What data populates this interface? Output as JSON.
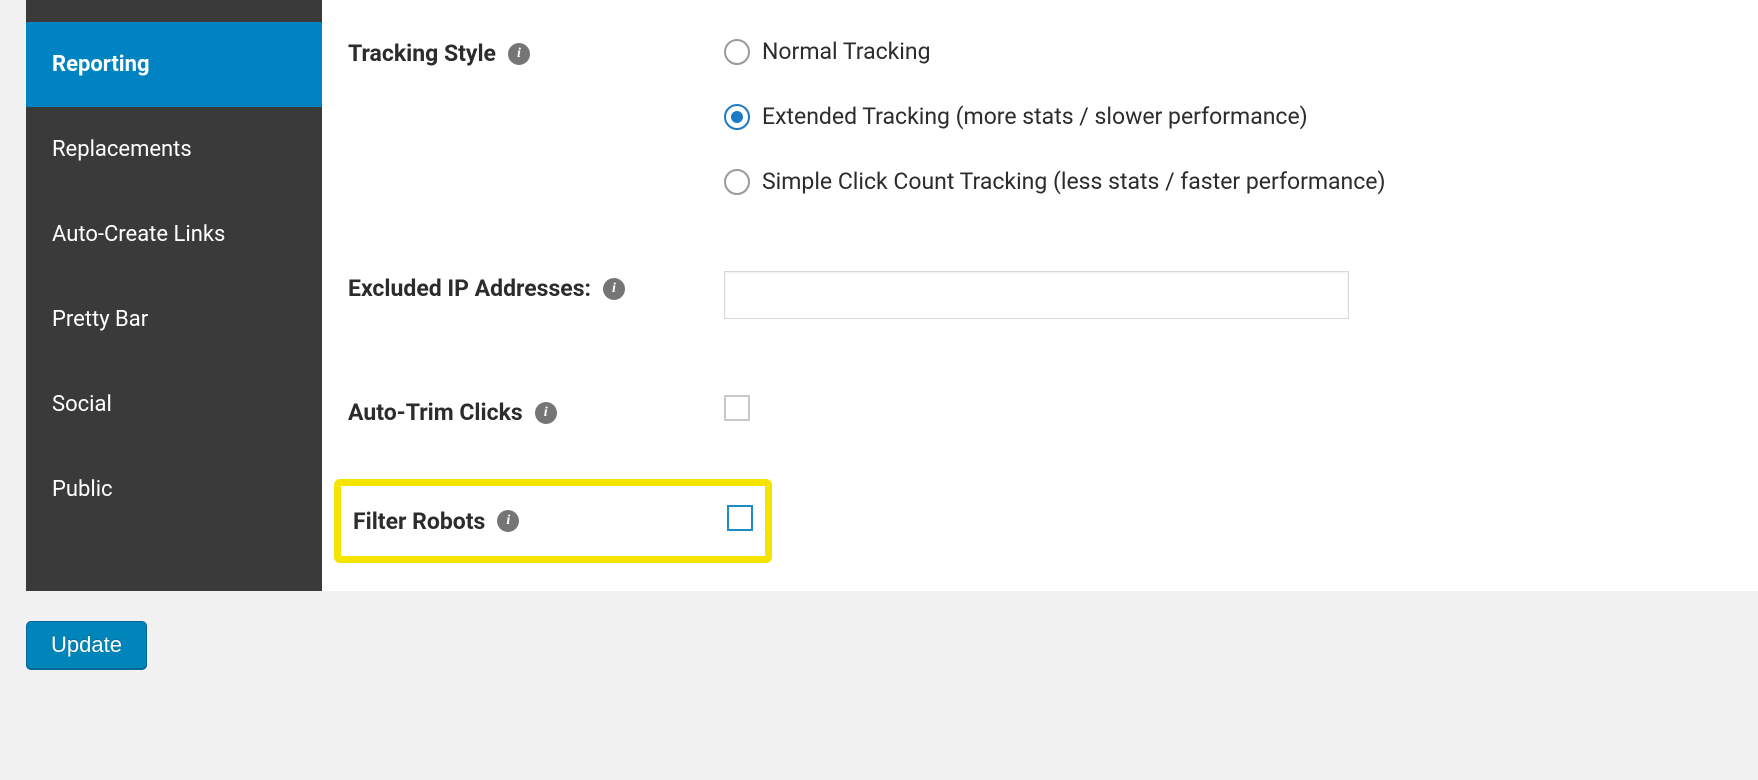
{
  "sidebar": {
    "items": [
      {
        "label": "Reporting"
      },
      {
        "label": "Replacements"
      },
      {
        "label": "Auto-Create Links"
      },
      {
        "label": "Pretty Bar"
      },
      {
        "label": "Social"
      },
      {
        "label": "Public"
      }
    ]
  },
  "settings": {
    "tracking_style": {
      "label": "Tracking Style",
      "options": {
        "normal": "Normal Tracking",
        "extended": "Extended Tracking (more stats / slower performance)",
        "simple": "Simple Click Count Tracking (less stats / faster performance)"
      },
      "selected": "extended"
    },
    "excluded_ips": {
      "label": "Excluded IP Addresses:",
      "value": ""
    },
    "auto_trim": {
      "label": "Auto-Trim Clicks",
      "checked": false
    },
    "filter_robots": {
      "label": "Filter Robots",
      "checked": false
    }
  },
  "actions": {
    "update_label": "Update"
  },
  "icons": {
    "info": "i"
  }
}
